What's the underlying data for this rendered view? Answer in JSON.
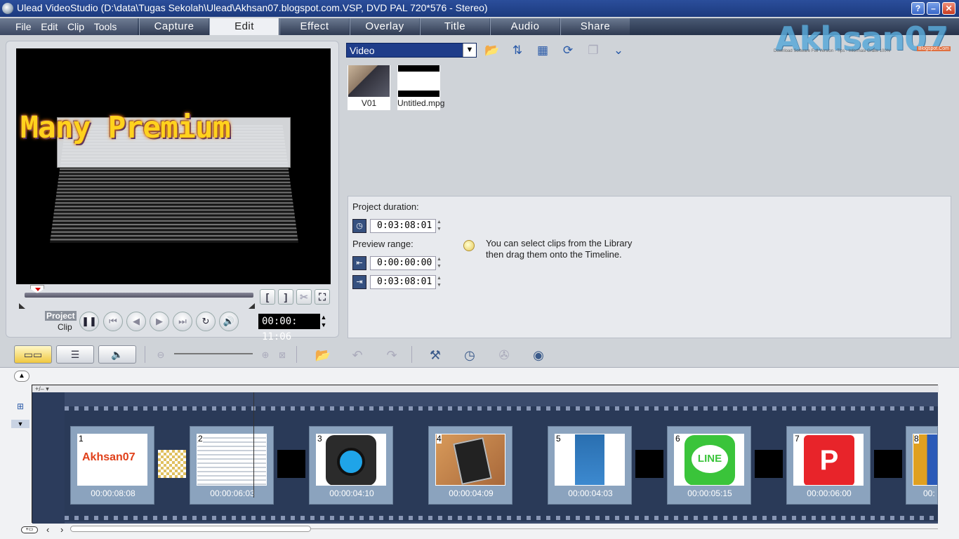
{
  "window": {
    "title": "Ulead VideoStudio (D:\\data\\Tugas Sekolah\\Ulead\\Akhsan07.blogspot.com.VSP, DVD PAL 720*576 - Stereo)",
    "help_label": "?",
    "minimize_label": "–",
    "maximize_label": "□",
    "close_label": "✕"
  },
  "menu": [
    "File",
    "Edit",
    "Clip",
    "Tools"
  ],
  "steps": [
    "Capture",
    "Edit",
    "Effect",
    "Overlay",
    "Title",
    "Audio",
    "Share"
  ],
  "active_step": "Edit",
  "logo": {
    "text": "Akhsan07",
    "tagline": "Download Software Full Version - Tips - Informasi Gratis 100%",
    "badge": "Blogspot.Com"
  },
  "preview": {
    "title_text": "Many Premium",
    "mode_project": "Project",
    "mode_clip": "Clip",
    "timecode": "00:00: 11:06",
    "mark_in_label": "[",
    "mark_out_label": "]"
  },
  "library": {
    "category": "Video",
    "items": [
      {
        "name": "V01"
      },
      {
        "name": "Untitled.mpg"
      }
    ]
  },
  "options": {
    "project_duration_label": "Project duration:",
    "project_duration": "0:03:08:01",
    "preview_range_label": "Preview range:",
    "range_start": "0:00:00:00",
    "range_end": "0:03:08:01",
    "hint_line1": "You can select clips from the Library",
    "hint_line2": "then drag them onto the Timeline."
  },
  "timeline": {
    "clips": [
      {
        "num": "1",
        "duration": "00:00:08:08"
      },
      {
        "num": "2",
        "duration": "00:00:06:03"
      },
      {
        "num": "3",
        "duration": "00:00:04:10"
      },
      {
        "num": "4",
        "duration": "00:00:04:09"
      },
      {
        "num": "5",
        "duration": "00:00:04:03"
      },
      {
        "num": "6",
        "duration": "00:00:05:15"
      },
      {
        "num": "7",
        "duration": "00:00:06:00"
      },
      {
        "num": "8",
        "duration": "00:"
      }
    ],
    "line_app_label": "LINE",
    "track_head_label": "+/– ▾"
  },
  "colors": {
    "accent": "#1f3d8a",
    "title_yellow": "#ffd21e",
    "film": "#2a3a58"
  },
  "icons": [
    "folder-open-icon",
    "sort-icon",
    "library-manager-icon",
    "batch-convert-icon",
    "library-options-icon",
    "expand-icon",
    "storyboard-view-icon",
    "timeline-view-icon",
    "audio-view-icon",
    "zoom-out-icon",
    "zoom-in-icon",
    "fit-project-icon",
    "insert-media-icon",
    "undo-icon",
    "redo-icon",
    "smart-proxy-icon",
    "batch-render-icon",
    "audio-mixer-icon",
    "surround-51-icon"
  ]
}
